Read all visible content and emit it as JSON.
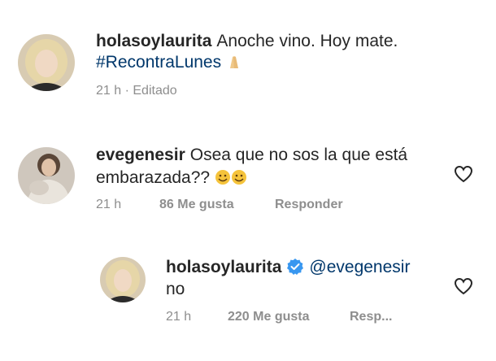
{
  "comments": [
    {
      "username": "holasoylaurita",
      "text": "Anoche vino. Hoy mate.",
      "hashtag": "#RecontraLunes",
      "emoji_icon": "pray-hands-emoji-icon",
      "time": "21 h",
      "separator": "·",
      "edited": "Editado"
    },
    {
      "username": "evegenesir",
      "text_line1": "Osea que no sos la que está",
      "text_line2": "embarazada??",
      "emoji_icon": "grinning-face-emoji-icon",
      "time": "21 h",
      "likes": "86 Me gusta",
      "reply": "Responder"
    },
    {
      "username": "holasoylaurita",
      "verified": true,
      "mention": "@evegenesir",
      "text": "no",
      "time": "21 h",
      "likes": "220 Me gusta",
      "reply": "Resp..."
    }
  ],
  "colors": {
    "text": "#262626",
    "meta": "#8e8e8e",
    "link": "#00376b",
    "verified": "#3897f0"
  }
}
